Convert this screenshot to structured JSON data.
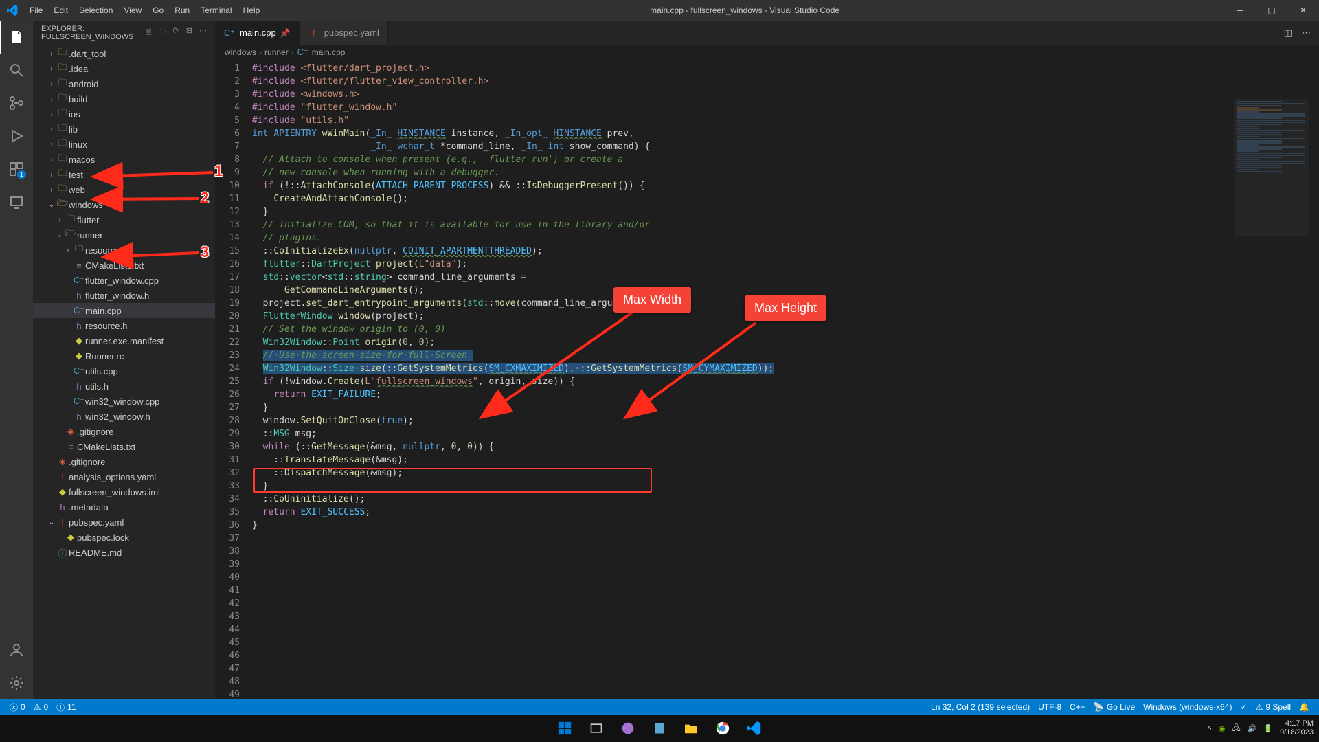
{
  "window": {
    "title": "main.cpp - fullscreen_windows - Visual Studio Code"
  },
  "menu": [
    "File",
    "Edit",
    "Selection",
    "View",
    "Go",
    "Run",
    "Terminal",
    "Help"
  ],
  "explorer": {
    "title": "EXPLORER: FULLSCREEN_WINDOWS",
    "items": [
      {
        "indent": 1,
        "chev": "›",
        "icon": "folder",
        "name": ".dart_tool"
      },
      {
        "indent": 1,
        "chev": "›",
        "icon": "folder",
        "name": ".idea"
      },
      {
        "indent": 1,
        "chev": "›",
        "icon": "folder",
        "name": "android"
      },
      {
        "indent": 1,
        "chev": "›",
        "icon": "folder",
        "name": "build"
      },
      {
        "indent": 1,
        "chev": "›",
        "icon": "folder",
        "name": "ios"
      },
      {
        "indent": 1,
        "chev": "›",
        "icon": "folder",
        "name": "lib"
      },
      {
        "indent": 1,
        "chev": "›",
        "icon": "folder",
        "name": "linux"
      },
      {
        "indent": 1,
        "chev": "›",
        "icon": "folder",
        "name": "macos"
      },
      {
        "indent": 1,
        "chev": "›",
        "icon": "folder",
        "name": "test"
      },
      {
        "indent": 1,
        "chev": "›",
        "icon": "folder",
        "name": "web"
      },
      {
        "indent": 1,
        "chev": "⌄",
        "icon": "folder-open",
        "name": "windows"
      },
      {
        "indent": 2,
        "chev": "›",
        "icon": "folder",
        "name": "flutter"
      },
      {
        "indent": 2,
        "chev": "⌄",
        "icon": "folder-open",
        "name": "runner"
      },
      {
        "indent": 3,
        "chev": "›",
        "icon": "folder",
        "iconClass": "yellow",
        "name": "resources"
      },
      {
        "indent": 3,
        "chev": "",
        "icon": "txt",
        "name": "CMakeLists.txt"
      },
      {
        "indent": 3,
        "chev": "",
        "icon": "cpp",
        "name": "flutter_window.cpp"
      },
      {
        "indent": 3,
        "chev": "",
        "icon": "h",
        "name": "flutter_window.h"
      },
      {
        "indent": 3,
        "chev": "",
        "icon": "cpp",
        "name": "main.cpp",
        "selected": true
      },
      {
        "indent": 3,
        "chev": "",
        "icon": "h",
        "name": "resource.h"
      },
      {
        "indent": 3,
        "chev": "",
        "icon": "yellow",
        "name": "runner.exe.manifest"
      },
      {
        "indent": 3,
        "chev": "",
        "icon": "yellow",
        "name": "Runner.rc"
      },
      {
        "indent": 3,
        "chev": "",
        "icon": "cpp",
        "name": "utils.cpp"
      },
      {
        "indent": 3,
        "chev": "",
        "icon": "h",
        "name": "utils.h"
      },
      {
        "indent": 3,
        "chev": "",
        "icon": "cpp",
        "name": "win32_window.cpp"
      },
      {
        "indent": 3,
        "chev": "",
        "icon": "h",
        "name": "win32_window.h"
      },
      {
        "indent": 2,
        "chev": "",
        "icon": "git",
        "name": ".gitignore"
      },
      {
        "indent": 2,
        "chev": "",
        "icon": "txt",
        "name": "CMakeLists.txt"
      },
      {
        "indent": 1,
        "chev": "",
        "icon": "git",
        "name": ".gitignore"
      },
      {
        "indent": 1,
        "chev": "",
        "icon": "yaml",
        "name": "analysis_options.yaml"
      },
      {
        "indent": 1,
        "chev": "",
        "icon": "yellow",
        "name": "fullscreen_windows.iml"
      },
      {
        "indent": 1,
        "chev": "",
        "icon": "h",
        "name": ".metadata"
      },
      {
        "indent": 1,
        "chev": "⌄",
        "icon": "yaml",
        "name": "pubspec.yaml"
      },
      {
        "indent": 2,
        "chev": "",
        "icon": "yellow",
        "name": "pubspec.lock"
      },
      {
        "indent": 1,
        "chev": "",
        "icon": "info",
        "name": "README.md"
      }
    ]
  },
  "tabs": [
    {
      "icon": "cpp",
      "label": "main.cpp",
      "active": true,
      "pinned": true
    },
    {
      "icon": "yaml",
      "label": "pubspec.yaml",
      "active": false
    }
  ],
  "breadcrumb": [
    "windows",
    "runner",
    "main.cpp"
  ],
  "breadcrumbIcon": "C++",
  "statusbar": {
    "errors": "0",
    "warnings": "0",
    "info": "11",
    "lncol": "Ln 32, Col 2 (139 selected)",
    "encoding": "UTF-8",
    "lang": "C++",
    "golive": "Go Live",
    "platform": "Windows (windows-x64)",
    "spell": "9 Spell"
  },
  "taskbar": {
    "time": "4:17 PM",
    "date": "9/18/2023"
  },
  "callouts": {
    "width": "Max Width",
    "height": "Max Height"
  },
  "arrows": {
    "n1": "1",
    "n2": "2",
    "n3": "3"
  }
}
